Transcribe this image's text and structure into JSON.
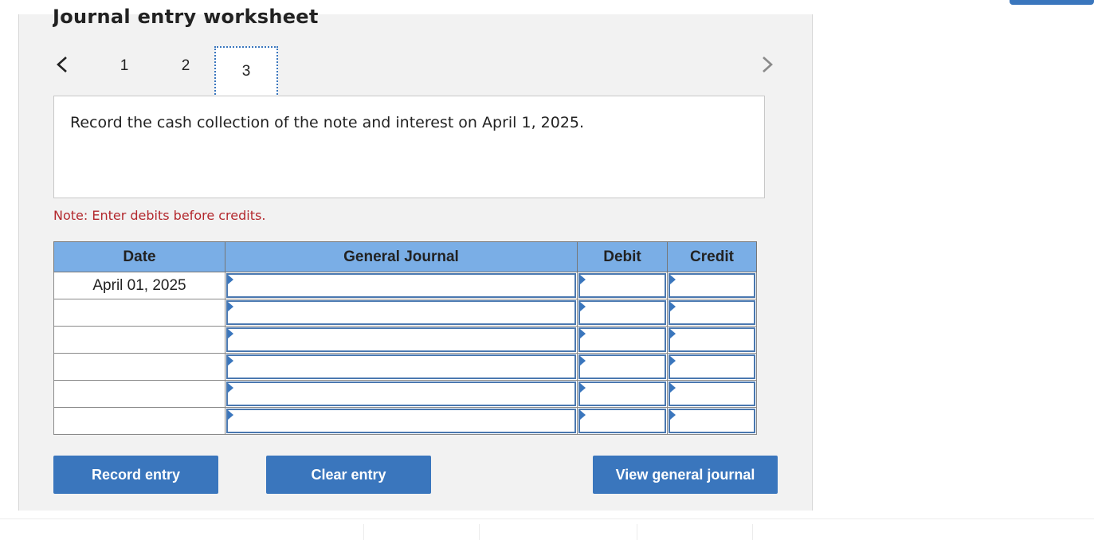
{
  "worksheet": {
    "title": "Journal entry worksheet",
    "steps": [
      "1",
      "2",
      "3"
    ],
    "active_step": "3",
    "prompt": "Record the cash collection of the note and interest on April 1, 2025.",
    "note": "Note: Enter debits before credits."
  },
  "table": {
    "headers": {
      "date": "Date",
      "general_journal": "General Journal",
      "debit": "Debit",
      "credit": "Credit"
    },
    "rows": [
      {
        "date": "April 01, 2025",
        "account": "",
        "debit": "",
        "credit": ""
      },
      {
        "date": "",
        "account": "",
        "debit": "",
        "credit": ""
      },
      {
        "date": "",
        "account": "",
        "debit": "",
        "credit": ""
      },
      {
        "date": "",
        "account": "",
        "debit": "",
        "credit": ""
      },
      {
        "date": "",
        "account": "",
        "debit": "",
        "credit": ""
      },
      {
        "date": "",
        "account": "",
        "debit": "",
        "credit": ""
      }
    ]
  },
  "buttons": {
    "record": "Record entry",
    "clear": "Clear entry",
    "view": "View general journal"
  },
  "colors": {
    "accent": "#3a76bd",
    "header": "#7aaee6",
    "note": "#b3282d",
    "panel": "#f2f2f2"
  },
  "icons": {
    "prev": "chevron-left-icon",
    "next": "chevron-right-icon",
    "input_marker": "triangle-right-icon"
  }
}
